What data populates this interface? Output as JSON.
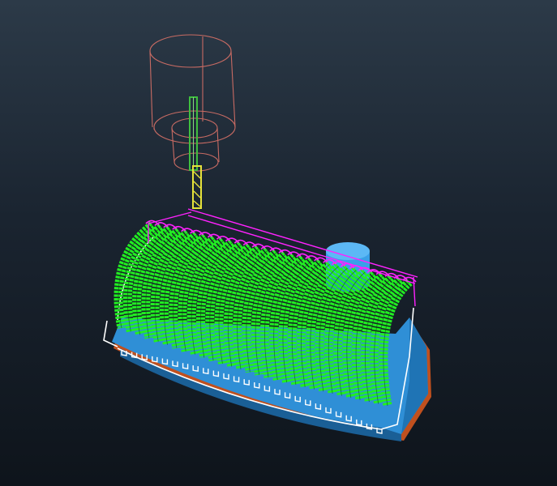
{
  "viewport": {
    "background_top": "#2c3a48",
    "background_bottom": "#0e141b"
  },
  "scene": {
    "tool_holder_color": "#c86b63",
    "tool_shank_color": "#3fbf3f",
    "cutter_color": "#e6e23a",
    "toolpath_color": "#22ee22",
    "toolpath_link_color": "#ff22ff",
    "stock_outline_color": "#ffffff",
    "part_base_color": "#2f8fd6",
    "part_base_dark": "#1a5f96",
    "part_boss_color": "#3aa0e8",
    "part_bottom_edge": "#c0501e",
    "toolpath_passes": 30
  }
}
